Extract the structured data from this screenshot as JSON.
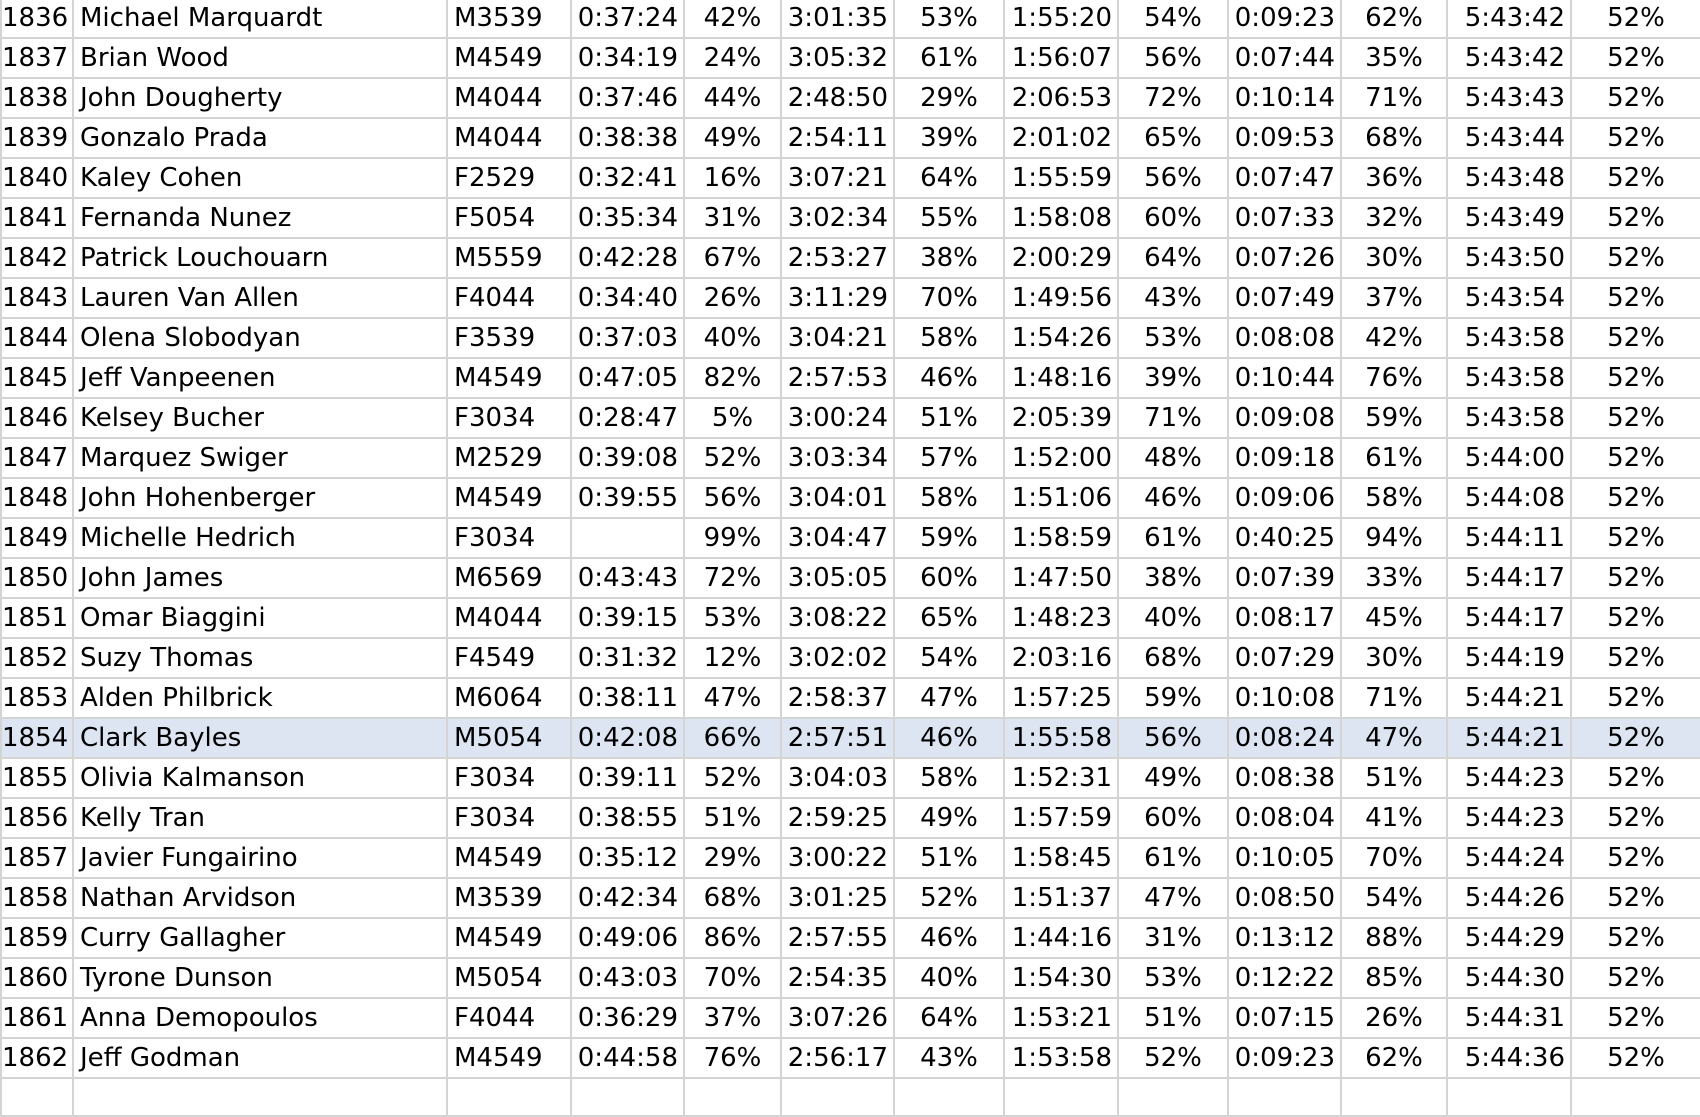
{
  "sheet": {
    "selected_row": 18,
    "rows": [
      [
        "1836",
        "Michael Marquardt",
        "M3539",
        "0:37:24",
        "42%",
        "3:01:35",
        "53%",
        "1:55:20",
        "54%",
        "0:09:23",
        "62%",
        "5:43:42",
        "52%"
      ],
      [
        "1837",
        "Brian Wood",
        "M4549",
        "0:34:19",
        "24%",
        "3:05:32",
        "61%",
        "1:56:07",
        "56%",
        "0:07:44",
        "35%",
        "5:43:42",
        "52%"
      ],
      [
        "1838",
        "John Dougherty",
        "M4044",
        "0:37:46",
        "44%",
        "2:48:50",
        "29%",
        "2:06:53",
        "72%",
        "0:10:14",
        "71%",
        "5:43:43",
        "52%"
      ],
      [
        "1839",
        "Gonzalo Prada",
        "M4044",
        "0:38:38",
        "49%",
        "2:54:11",
        "39%",
        "2:01:02",
        "65%",
        "0:09:53",
        "68%",
        "5:43:44",
        "52%"
      ],
      [
        "1840",
        "Kaley Cohen",
        "F2529",
        "0:32:41",
        "16%",
        "3:07:21",
        "64%",
        "1:55:59",
        "56%",
        "0:07:47",
        "36%",
        "5:43:48",
        "52%"
      ],
      [
        "1841",
        "Fernanda Nunez",
        "F5054",
        "0:35:34",
        "31%",
        "3:02:34",
        "55%",
        "1:58:08",
        "60%",
        "0:07:33",
        "32%",
        "5:43:49",
        "52%"
      ],
      [
        "1842",
        "Patrick Louchouarn",
        "M5559",
        "0:42:28",
        "67%",
        "2:53:27",
        "38%",
        "2:00:29",
        "64%",
        "0:07:26",
        "30%",
        "5:43:50",
        "52%"
      ],
      [
        "1843",
        "Lauren Van Allen",
        "F4044",
        "0:34:40",
        "26%",
        "3:11:29",
        "70%",
        "1:49:56",
        "43%",
        "0:07:49",
        "37%",
        "5:43:54",
        "52%"
      ],
      [
        "1844",
        "Olena Slobodyan",
        "F3539",
        "0:37:03",
        "40%",
        "3:04:21",
        "58%",
        "1:54:26",
        "53%",
        "0:08:08",
        "42%",
        "5:43:58",
        "52%"
      ],
      [
        "1845",
        "Jeff Vanpeenen",
        "M4549",
        "0:47:05",
        "82%",
        "2:57:53",
        "46%",
        "1:48:16",
        "39%",
        "0:10:44",
        "76%",
        "5:43:58",
        "52%"
      ],
      [
        "1846",
        "Kelsey Bucher",
        "F3034",
        "0:28:47",
        "5%",
        "3:00:24",
        "51%",
        "2:05:39",
        "71%",
        "0:09:08",
        "59%",
        "5:43:58",
        "52%"
      ],
      [
        "1847",
        "Marquez Swiger",
        "M2529",
        "0:39:08",
        "52%",
        "3:03:34",
        "57%",
        "1:52:00",
        "48%",
        "0:09:18",
        "61%",
        "5:44:00",
        "52%"
      ],
      [
        "1848",
        "John Hohenberger",
        "M4549",
        "0:39:55",
        "56%",
        "3:04:01",
        "58%",
        "1:51:06",
        "46%",
        "0:09:06",
        "58%",
        "5:44:08",
        "52%"
      ],
      [
        "1849",
        "Michelle Hedrich",
        "F3034",
        "",
        "99%",
        "3:04:47",
        "59%",
        "1:58:59",
        "61%",
        "0:40:25",
        "94%",
        "5:44:11",
        "52%"
      ],
      [
        "1850",
        "John James",
        "M6569",
        "0:43:43",
        "72%",
        "3:05:05",
        "60%",
        "1:47:50",
        "38%",
        "0:07:39",
        "33%",
        "5:44:17",
        "52%"
      ],
      [
        "1851",
        "Omar Biaggini",
        "M4044",
        "0:39:15",
        "53%",
        "3:08:22",
        "65%",
        "1:48:23",
        "40%",
        "0:08:17",
        "45%",
        "5:44:17",
        "52%"
      ],
      [
        "1852",
        "Suzy Thomas",
        "F4549",
        "0:31:32",
        "12%",
        "3:02:02",
        "54%",
        "2:03:16",
        "68%",
        "0:07:29",
        "30%",
        "5:44:19",
        "52%"
      ],
      [
        "1853",
        "Alden Philbrick",
        "M6064",
        "0:38:11",
        "47%",
        "2:58:37",
        "47%",
        "1:57:25",
        "59%",
        "0:10:08",
        "71%",
        "5:44:21",
        "52%"
      ],
      [
        "1854",
        "Clark Bayles",
        "M5054",
        "0:42:08",
        "66%",
        "2:57:51",
        "46%",
        "1:55:58",
        "56%",
        "0:08:24",
        "47%",
        "5:44:21",
        "52%"
      ],
      [
        "1855",
        "Olivia Kalmanson",
        "F3034",
        "0:39:11",
        "52%",
        "3:04:03",
        "58%",
        "1:52:31",
        "49%",
        "0:08:38",
        "51%",
        "5:44:23",
        "52%"
      ],
      [
        "1856",
        "Kelly Tran",
        "F3034",
        "0:38:55",
        "51%",
        "2:59:25",
        "49%",
        "1:57:59",
        "60%",
        "0:08:04",
        "41%",
        "5:44:23",
        "52%"
      ],
      [
        "1857",
        "Javier Fungairino",
        "M4549",
        "0:35:12",
        "29%",
        "3:00:22",
        "51%",
        "1:58:45",
        "61%",
        "0:10:05",
        "70%",
        "5:44:24",
        "52%"
      ],
      [
        "1858",
        "Nathan Arvidson",
        "M3539",
        "0:42:34",
        "68%",
        "3:01:25",
        "52%",
        "1:51:37",
        "47%",
        "0:08:50",
        "54%",
        "5:44:26",
        "52%"
      ],
      [
        "1859",
        "Curry Gallagher",
        "M4549",
        "0:49:06",
        "86%",
        "2:57:55",
        "46%",
        "1:44:16",
        "31%",
        "0:13:12",
        "88%",
        "5:44:29",
        "52%"
      ],
      [
        "1860",
        "Tyrone Dunson",
        "M5054",
        "0:43:03",
        "70%",
        "2:54:35",
        "40%",
        "1:54:30",
        "53%",
        "0:12:22",
        "85%",
        "5:44:30",
        "52%"
      ],
      [
        "1861",
        "Anna Demopoulos",
        "F4044",
        "0:36:29",
        "37%",
        "3:07:26",
        "64%",
        "1:53:21",
        "51%",
        "0:07:15",
        "26%",
        "5:44:31",
        "52%"
      ],
      [
        "1862",
        "Jeff Godman",
        "M4549",
        "0:44:58",
        "76%",
        "2:56:17",
        "43%",
        "1:53:58",
        "52%",
        "0:09:23",
        "62%",
        "5:44:36",
        "52%"
      ],
      [
        "",
        "",
        "",
        "",
        "",
        "",
        "",
        "",
        "",
        "",
        "",
        "",
        ""
      ]
    ],
    "colors": {
      "grid": "#d4d4d4",
      "selected_bg": "#dde5f3"
    }
  }
}
